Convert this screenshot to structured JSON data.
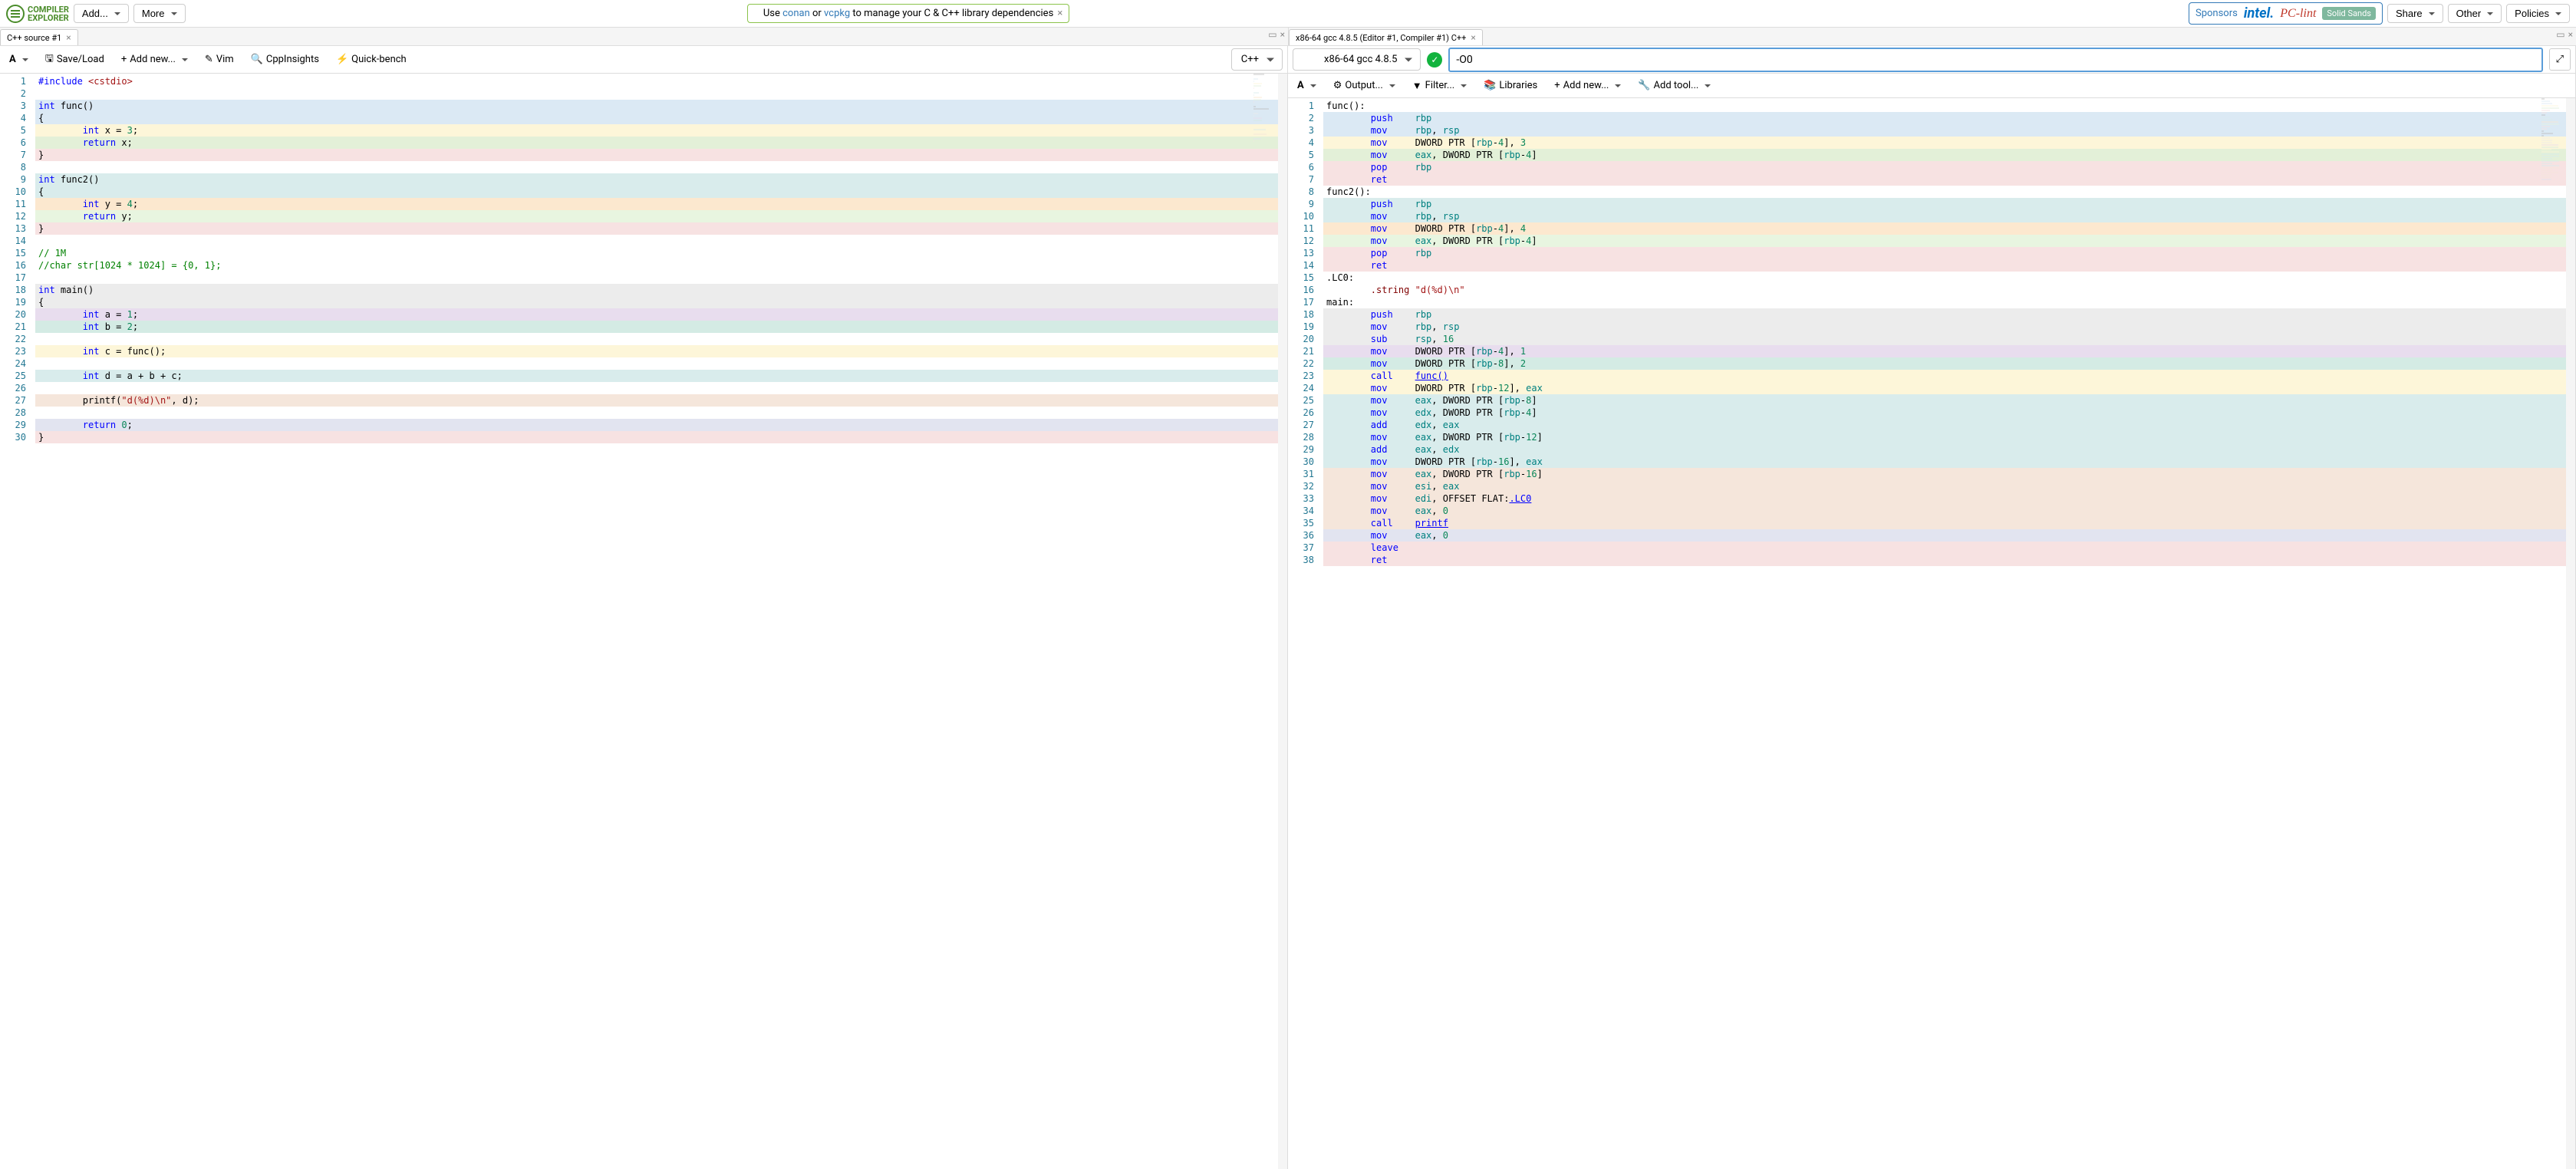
{
  "logo": {
    "line1": "COMPILER",
    "line2": "EXPLORER"
  },
  "nav": {
    "add": "Add...",
    "more": "More",
    "share": "Share",
    "other": "Other",
    "policies": "Policies"
  },
  "banner": {
    "prefix": "Use ",
    "conan": "conan",
    "or": " or ",
    "vcpkg": "vcpkg",
    "suffix": " to manage your C & C++ library dependencies"
  },
  "sponsors": {
    "label": "Sponsors",
    "intel": "intel.",
    "pclint": "PC-lint",
    "solid": "Solid Sands"
  },
  "tabs": {
    "left": "C++ source #1",
    "right": "x86-64 gcc 4.8.5 (Editor #1, Compiler #1) C++"
  },
  "editor_toolbar": {
    "font": "A",
    "saveload": "Save/Load",
    "addnew": "Add new...",
    "vim": "Vim",
    "cppinsights": "CppInsights",
    "quickbench": "Quick-bench",
    "lang": "C++"
  },
  "compiler_top": {
    "compiler": "x86-64 gcc 4.8.5",
    "flags": "-O0"
  },
  "compiler_toolbar": {
    "font": "A",
    "output": "Output...",
    "filter": "Filter...",
    "libraries": "Libraries",
    "addnew": "Add new...",
    "addtool": "Add tool..."
  },
  "source_lines": [
    {
      "n": 1,
      "bg": "",
      "html": "<span class='pp'>#include</span> <span class='ppinc'>&lt;cstdio&gt;</span>"
    },
    {
      "n": 2,
      "bg": "",
      "html": ""
    },
    {
      "n": 3,
      "bg": "bg-lightblue",
      "html": "<span class='type'>int</span> func()"
    },
    {
      "n": 4,
      "bg": "bg-lightblue",
      "html": "{"
    },
    {
      "n": 5,
      "bg": "bg-yellow",
      "html": "        <span class='type'>int</span> x = <span class='num'>3</span>;"
    },
    {
      "n": 6,
      "bg": "bg-green",
      "html": "        <span class='kw'>return</span> x;"
    },
    {
      "n": 7,
      "bg": "bg-pink",
      "html": "}"
    },
    {
      "n": 8,
      "bg": "",
      "html": ""
    },
    {
      "n": 9,
      "bg": "bg-lightcyan",
      "html": "<span class='type'>int</span> func2()"
    },
    {
      "n": 10,
      "bg": "bg-lightcyan",
      "html": "{"
    },
    {
      "n": 11,
      "bg": "bg-orange",
      "html": "        <span class='type'>int</span> y = <span class='num'>4</span>;"
    },
    {
      "n": 12,
      "bg": "bg-palegreen",
      "html": "        <span class='kw'>return</span> y;"
    },
    {
      "n": 13,
      "bg": "bg-pink",
      "html": "}"
    },
    {
      "n": 14,
      "bg": "",
      "html": ""
    },
    {
      "n": 15,
      "bg": "",
      "html": "<span class='cmt'>// 1M</span>"
    },
    {
      "n": 16,
      "bg": "",
      "html": "<span class='cmt'>//char str[1024 * 1024] = {0, 1};</span>"
    },
    {
      "n": 17,
      "bg": "",
      "html": ""
    },
    {
      "n": 18,
      "bg": "bg-grey",
      "html": "<span class='type'>int</span> main()"
    },
    {
      "n": 19,
      "bg": "bg-grey",
      "html": "{"
    },
    {
      "n": 20,
      "bg": "bg-purple",
      "html": "        <span class='type'>int</span> a = <span class='num'>1</span>;"
    },
    {
      "n": 21,
      "bg": "bg-teal",
      "html": "        <span class='type'>int</span> b = <span class='num'>2</span>;"
    },
    {
      "n": 22,
      "bg": "",
      "html": ""
    },
    {
      "n": 23,
      "bg": "bg-yellow",
      "html": "        <span class='type'>int</span> c = func();"
    },
    {
      "n": 24,
      "bg": "",
      "html": ""
    },
    {
      "n": 25,
      "bg": "bg-lightcyan",
      "html": "        <span class='type'>int</span> d = a + b + c;"
    },
    {
      "n": 26,
      "bg": "",
      "html": ""
    },
    {
      "n": 27,
      "bg": "bg-peach",
      "html": "        printf(<span class='str'>\"d(%d)\\n\"</span>, d);"
    },
    {
      "n": 28,
      "bg": "",
      "html": ""
    },
    {
      "n": 29,
      "bg": "bg-lav",
      "html": "        <span class='kw'>return</span> <span class='num'>0</span>;"
    },
    {
      "n": 30,
      "bg": "bg-pink",
      "html": "}"
    }
  ],
  "asm_lines": [
    {
      "n": 1,
      "bg": "",
      "html": "<span class='asm-label'>func():</span>"
    },
    {
      "n": 2,
      "bg": "bg-lightblue",
      "html": "        <span class='asm-kw'>push</span>    <span class='reg'>rbp</span>"
    },
    {
      "n": 3,
      "bg": "bg-lightblue",
      "html": "        <span class='asm-kw'>mov</span>     <span class='reg'>rbp</span>, <span class='reg'>rsp</span>"
    },
    {
      "n": 4,
      "bg": "bg-yellow",
      "html": "        <span class='asm-kw'>mov</span>     DWORD PTR [<span class='reg'>rbp</span>-<span class='num'>4</span>], <span class='num'>3</span>"
    },
    {
      "n": 5,
      "bg": "bg-green",
      "html": "        <span class='asm-kw'>mov</span>     <span class='reg'>eax</span>, DWORD PTR [<span class='reg'>rbp</span>-<span class='num'>4</span>]"
    },
    {
      "n": 6,
      "bg": "bg-pink",
      "html": "        <span class='asm-kw'>pop</span>     <span class='reg'>rbp</span>"
    },
    {
      "n": 7,
      "bg": "bg-pink",
      "html": "        <span class='asm-kw'>ret</span>"
    },
    {
      "n": 8,
      "bg": "",
      "html": "<span class='asm-label'>func2():</span>"
    },
    {
      "n": 9,
      "bg": "bg-lightcyan",
      "html": "        <span class='asm-kw'>push</span>    <span class='reg'>rbp</span>"
    },
    {
      "n": 10,
      "bg": "bg-lightcyan",
      "html": "        <span class='asm-kw'>mov</span>     <span class='reg'>rbp</span>, <span class='reg'>rsp</span>"
    },
    {
      "n": 11,
      "bg": "bg-orange",
      "html": "        <span class='asm-kw'>mov</span>     DWORD PTR [<span class='reg'>rbp</span>-<span class='num'>4</span>], <span class='num'>4</span>"
    },
    {
      "n": 12,
      "bg": "bg-palegreen",
      "html": "        <span class='asm-kw'>mov</span>     <span class='reg'>eax</span>, DWORD PTR [<span class='reg'>rbp</span>-<span class='num'>4</span>]"
    },
    {
      "n": 13,
      "bg": "bg-pink",
      "html": "        <span class='asm-kw'>pop</span>     <span class='reg'>rbp</span>"
    },
    {
      "n": 14,
      "bg": "bg-pink",
      "html": "        <span class='asm-kw'>ret</span>"
    },
    {
      "n": 15,
      "bg": "",
      "html": "<span class='asm-label'>.LC0:</span>"
    },
    {
      "n": 16,
      "bg": "",
      "html": "        <span class='asm-dir'>.string</span> <span class='str'>\"d(%d)\\n\"</span>"
    },
    {
      "n": 17,
      "bg": "",
      "html": "<span class='asm-label'>main:</span>"
    },
    {
      "n": 18,
      "bg": "bg-grey",
      "html": "        <span class='asm-kw'>push</span>    <span class='reg'>rbp</span>"
    },
    {
      "n": 19,
      "bg": "bg-grey",
      "html": "        <span class='asm-kw'>mov</span>     <span class='reg'>rbp</span>, <span class='reg'>rsp</span>"
    },
    {
      "n": 20,
      "bg": "bg-grey",
      "html": "        <span class='asm-kw'>sub</span>     <span class='reg'>rsp</span>, <span class='num'>16</span>"
    },
    {
      "n": 21,
      "bg": "bg-purple",
      "html": "        <span class='asm-kw'>mov</span>     DWORD PTR [<span class='reg'>rbp</span>-<span class='num'>4</span>], <span class='num'>1</span>"
    },
    {
      "n": 22,
      "bg": "bg-teal",
      "html": "        <span class='asm-kw'>mov</span>     DWORD PTR [<span class='reg'>rbp</span>-<span class='num'>8</span>], <span class='num'>2</span>"
    },
    {
      "n": 23,
      "bg": "bg-yellow",
      "html": "        <span class='asm-kw'>call</span>    <span class='link'>func()</span>"
    },
    {
      "n": 24,
      "bg": "bg-yellow",
      "html": "        <span class='asm-kw'>mov</span>     DWORD PTR [<span class='reg'>rbp</span>-<span class='num'>12</span>], <span class='reg'>eax</span>"
    },
    {
      "n": 25,
      "bg": "bg-lightcyan",
      "html": "        <span class='asm-kw'>mov</span>     <span class='reg'>eax</span>, DWORD PTR [<span class='reg'>rbp</span>-<span class='num'>8</span>]"
    },
    {
      "n": 26,
      "bg": "bg-lightcyan",
      "html": "        <span class='asm-kw'>mov</span>     <span class='reg'>edx</span>, DWORD PTR [<span class='reg'>rbp</span>-<span class='num'>4</span>]"
    },
    {
      "n": 27,
      "bg": "bg-lightcyan",
      "html": "        <span class='asm-kw'>add</span>     <span class='reg'>edx</span>, <span class='reg'>eax</span>"
    },
    {
      "n": 28,
      "bg": "bg-lightcyan",
      "html": "        <span class='asm-kw'>mov</span>     <span class='reg'>eax</span>, DWORD PTR [<span class='reg'>rbp</span>-<span class='num'>12</span>]"
    },
    {
      "n": 29,
      "bg": "bg-lightcyan",
      "html": "        <span class='asm-kw'>add</span>     <span class='reg'>eax</span>, <span class='reg'>edx</span>"
    },
    {
      "n": 30,
      "bg": "bg-lightcyan",
      "html": "        <span class='asm-kw'>mov</span>     DWORD PTR [<span class='reg'>rbp</span>-<span class='num'>16</span>], <span class='reg'>eax</span>"
    },
    {
      "n": 31,
      "bg": "bg-peach",
      "html": "        <span class='asm-kw'>mov</span>     <span class='reg'>eax</span>, DWORD PTR [<span class='reg'>rbp</span>-<span class='num'>16</span>]"
    },
    {
      "n": 32,
      "bg": "bg-peach",
      "html": "        <span class='asm-kw'>mov</span>     <span class='reg'>esi</span>, <span class='reg'>eax</span>"
    },
    {
      "n": 33,
      "bg": "bg-peach",
      "html": "        <span class='asm-kw'>mov</span>     <span class='reg'>edi</span>, OFFSET FLAT:<span class='link'>.LC0</span>"
    },
    {
      "n": 34,
      "bg": "bg-peach",
      "html": "        <span class='asm-kw'>mov</span>     <span class='reg'>eax</span>, <span class='num'>0</span>"
    },
    {
      "n": 35,
      "bg": "bg-peach",
      "html": "        <span class='asm-kw'>call</span>    <span class='link'>printf</span>"
    },
    {
      "n": 36,
      "bg": "bg-lav",
      "html": "        <span class='asm-kw'>mov</span>     <span class='reg'>eax</span>, <span class='num'>0</span>"
    },
    {
      "n": 37,
      "bg": "bg-pink",
      "html": "        <span class='asm-kw'>leave</span>"
    },
    {
      "n": 38,
      "bg": "bg-pink",
      "html": "        <span class='asm-kw'>ret</span>"
    }
  ]
}
